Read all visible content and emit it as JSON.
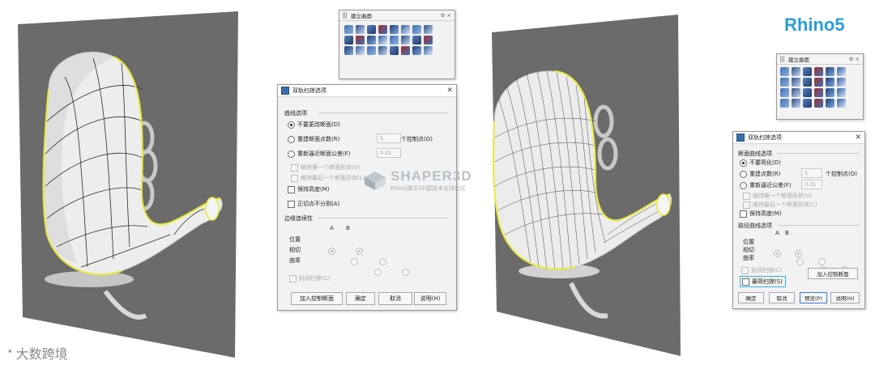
{
  "brand": {
    "rhino5": "Rhino5"
  },
  "watermark": {
    "center_text": "SHAPER3D",
    "center_sub": "Rhino(犀牛)中国技术支持社区",
    "bottom_left": "大数跨境"
  },
  "toolbar_left": {
    "title": "建立曲面"
  },
  "toolbar_right": {
    "title": "建立曲面"
  },
  "dialog_left": {
    "title": "双轨扫掠选项",
    "curve_options_label": "曲线选项",
    "options": [
      {
        "label": "不要更改断面(D)",
        "state": "on",
        "disabled": false
      },
      {
        "label": "重建断面点数(R)",
        "state": "off",
        "disabled": false,
        "value": "5",
        "suffix": "个控制点(O)"
      },
      {
        "label": "重新逼近断面公差(F)",
        "state": "off",
        "disabled": false,
        "value": "0.01"
      }
    ],
    "maintain_first": "维持第一个断面形状(V)",
    "maintain_last": "维持最后一个断面形状(L)",
    "keep_height": "保持高度(M)",
    "no_split": "正切点不分割(A)",
    "edge_continuity_label": "边缘连续性",
    "col_a": "A",
    "col_b": "B",
    "edge_rows": [
      "位置",
      "相切",
      "曲率"
    ],
    "closed_sweep": "封闭扫掠(C)",
    "buttons": {
      "add_section": "加入控制断面",
      "ok": "确定",
      "cancel": "取消",
      "help": "说明(H)"
    }
  },
  "dialog_right": {
    "title": "双轨扫掠选项",
    "section_options_label": "断面曲线选项",
    "options": [
      {
        "label": "不要简化(D)",
        "state": "on"
      },
      {
        "label": "重建点数(R)",
        "state": "off",
        "value": "5",
        "suffix": "个控制点(O)"
      },
      {
        "label": "重新逼近公差(F)",
        "state": "off",
        "value": "0.01"
      }
    ],
    "maintain_first": "维持第一个断面形状(V)",
    "maintain_last": "维持最后一个断面形状(L)",
    "keep_height": "保持高度(M)",
    "path_options_label": "路径曲线选项",
    "col_a": "A",
    "col_b": "B",
    "edge_rows": [
      "位置",
      "相切",
      "曲率"
    ],
    "closed_sweep": "封闭扫掠(C)",
    "simple_sweep": "最简扫掠(S)",
    "buttons": {
      "add_section": "加入控制断面",
      "ok": "确定",
      "cancel": "取消",
      "preview": "预览(P)",
      "help": "说明(H)"
    }
  },
  "colors": {
    "viewport_bg": "#6b6b6b",
    "edge_yellow": "#e8ea3a",
    "accent_blue": "#2a9fd6",
    "highlight_box": "#2bb3d9"
  }
}
